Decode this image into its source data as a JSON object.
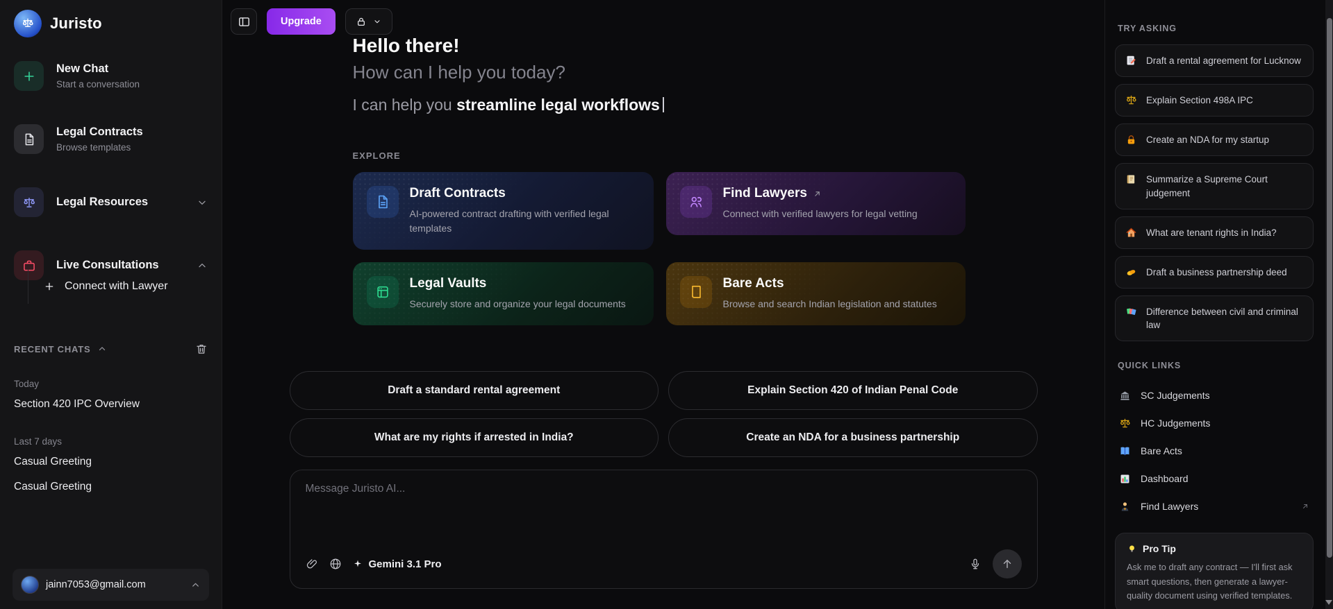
{
  "app": {
    "name": "Juristo"
  },
  "colors": {
    "upgrade_purple": "#8b2fe8",
    "new_chat_green": "#34d399",
    "resources_indigo": "#818cf8",
    "consultations_red": "#fb4d67",
    "draft_contracts_blue": "#5aa2f7",
    "find_lawyers_purple": "#c084fc",
    "legal_vaults_green": "#2dd98f",
    "bare_acts_amber": "#f5b62e"
  },
  "sidebar": {
    "logo_text": "Juristo",
    "items": [
      {
        "label": "New Chat",
        "sub": "Start a conversation"
      },
      {
        "label": "Legal Contracts",
        "sub": "Browse templates"
      },
      {
        "label": "Legal Resources"
      },
      {
        "label": "Live Consultations"
      },
      {
        "label": "Connect with Lawyer"
      }
    ],
    "recent": {
      "header": "RECENT CHATS",
      "groups": [
        {
          "label": "Today",
          "chats": [
            "Section 420 IPC Overview"
          ]
        },
        {
          "label": "Last 7 days",
          "chats": [
            "Casual Greeting",
            "Casual Greeting"
          ]
        }
      ]
    },
    "account": {
      "email": "jainn7053@gmail.com"
    }
  },
  "toolbar": {
    "upgrade_label": "Upgrade"
  },
  "hero": {
    "title": "Hello there!",
    "subtitle": "How can I help you today?",
    "typing_prefix": "I can help you ",
    "typing_bold": "streamline legal workflows"
  },
  "explore": {
    "header": "EXPLORE",
    "cards": [
      {
        "title": "Draft Contracts",
        "desc": "AI-powered contract drafting with verified legal templates",
        "icon": "document-icon",
        "accent": "#5aa2f7"
      },
      {
        "title": "Find Lawyers",
        "desc": "Connect with verified lawyers for legal vetting",
        "icon": "users-icon",
        "accent": "#c084fc",
        "external": true
      },
      {
        "title": "Legal Vaults",
        "desc": "Securely store and organize your legal documents",
        "icon": "vault-icon",
        "accent": "#2dd98f"
      },
      {
        "title": "Bare Acts",
        "desc": "Browse and search Indian legislation and statutes",
        "icon": "book-icon",
        "accent": "#f5b62e"
      }
    ]
  },
  "suggestions": [
    "Draft a standard rental agreement",
    "Explain Section 420 of Indian Penal Code",
    "What are my rights if arrested in India?",
    "Create an NDA for a business partnership"
  ],
  "composer": {
    "placeholder": "Message Juristo AI...",
    "model": "Gemini 3.1 Pro"
  },
  "try_asking": {
    "header": "TRY ASKING",
    "items": [
      {
        "icon": "memo-icon",
        "label": "Draft a rental agreement for Lucknow"
      },
      {
        "icon": "scales-icon",
        "label": "Explain Section 498A IPC"
      },
      {
        "icon": "lock-icon",
        "label": "Create an NDA for my startup"
      },
      {
        "icon": "scroll-icon",
        "label": "Summarize a Supreme Court judgement"
      },
      {
        "icon": "house-icon",
        "label": "What are tenant rights in India?"
      },
      {
        "icon": "handshake-icon",
        "label": "Draft a business partnership deed"
      },
      {
        "icon": "books-icon",
        "label": "Difference between civil and criminal law"
      }
    ]
  },
  "quick_links": {
    "header": "QUICK LINKS",
    "items": [
      {
        "icon": "bank-icon",
        "label": "SC Judgements"
      },
      {
        "icon": "scales-icon",
        "label": "HC Judgements"
      },
      {
        "icon": "open-book-icon",
        "label": "Bare Acts"
      },
      {
        "icon": "chart-icon",
        "label": "Dashboard"
      },
      {
        "icon": "lawyer-icon",
        "label": "Find Lawyers",
        "external": true
      }
    ]
  },
  "pro_tip": {
    "title": "Pro Tip",
    "body": "Ask me to draft any contract — I'll first ask smart questions, then generate a lawyer-quality document using verified templates."
  }
}
